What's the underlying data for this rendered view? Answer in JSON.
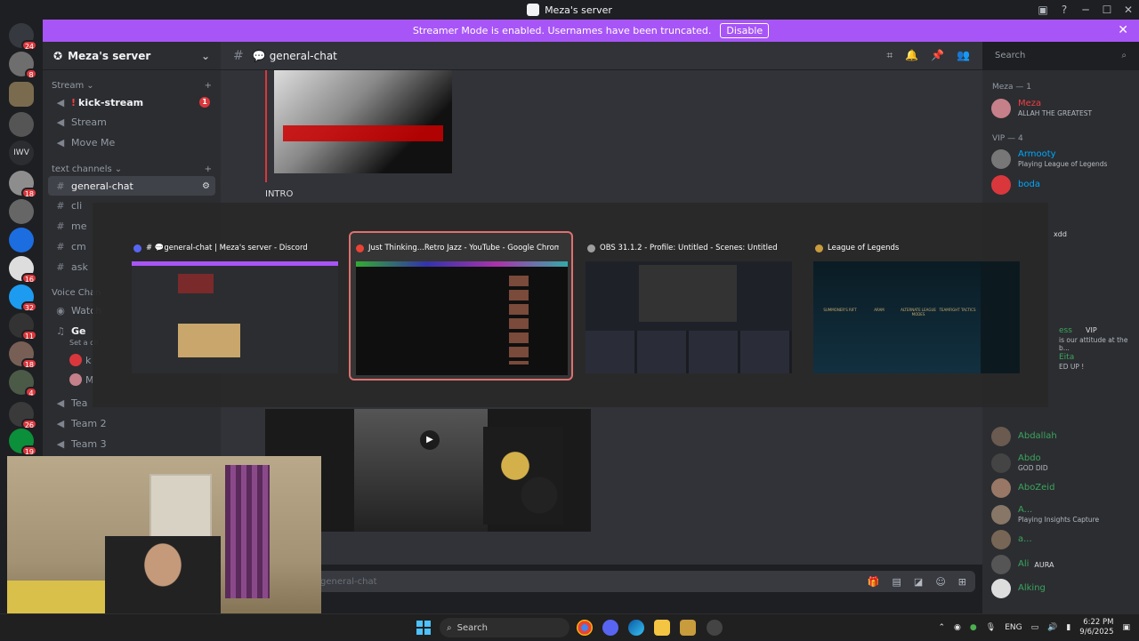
{
  "window": {
    "title": "Meza's server"
  },
  "banner": {
    "text": "Streamer Mode is enabled. Usernames have been truncated.",
    "disable_label": "Disable",
    "close_glyph": "✕"
  },
  "server_rail": {
    "badges": [
      "24",
      "8",
      "18",
      "16",
      "32",
      "11",
      "18",
      "4",
      "26",
      "19"
    ],
    "abbrev": "IWV"
  },
  "sidebar": {
    "server_name": "Meza's server",
    "stream_category": "Stream",
    "text_category": "text channels",
    "voice_category": "Voice Chan",
    "channels": {
      "kick": "kick-stream",
      "kick_unread": "1",
      "stream": "Stream",
      "moveme": "Move Me",
      "general": "general-chat",
      "clips": "cli",
      "me": "me",
      "cm": "cm",
      "ask": "ask",
      "watch": "Watch",
      "ge": "Ge",
      "ge_sub": "Set a ch",
      "k": "k",
      "m": "M",
      "team": "Tea",
      "team2": "Team 2",
      "team3": "Team 3"
    }
  },
  "chat_header": {
    "channel": "general-chat"
  },
  "search": {
    "placeholder": "Search"
  },
  "chat": {
    "intro": "INTRO",
    "composer_placeholder": "general-chat"
  },
  "members": {
    "group_owner": "Meza — 1",
    "group_vip": "VIP — 4",
    "list": [
      {
        "name": "Meza",
        "status": "ALLAH THE GREATEST",
        "color": "#f23f43"
      },
      {
        "name": "Armooty",
        "status": "Playing League of Legends",
        "color": "#00a8fc"
      },
      {
        "name": "boda",
        "status": "",
        "color": "#00a8fc"
      },
      {
        "name": "Abdallah",
        "status": "",
        "color": "#3ba55d"
      },
      {
        "name": "Abdo",
        "status": "GOD DID",
        "color": "#3ba55d"
      },
      {
        "name": "AboZeid",
        "status": "",
        "color": "#3ba55d"
      },
      {
        "name": "A...",
        "status": "Playing Insights Capture",
        "color": "#3ba55d"
      },
      {
        "name": "a...",
        "status": "",
        "color": "#3ba55d"
      },
      {
        "name": "Ali",
        "status": "AURA",
        "color": "#3ba55d"
      },
      {
        "name": "Alking",
        "status": "",
        "color": "#3ba55d"
      }
    ],
    "partial": {
      "xdd": "xdd",
      "ess": "ess",
      "vip": "VIP",
      "attitude": "is our attitude at the b...",
      "eita": "Eita",
      "eita_sub": "ED UP !"
    }
  },
  "switcher": {
    "windows": [
      {
        "title": "# 💬general-chat | Meza's server - Discord",
        "icon_color": "#5865f2"
      },
      {
        "title": "Just Thinking...Retro Jazz - YouTube - Google Chrome",
        "icon_color": "#ea4335"
      },
      {
        "title": "OBS 31.1.2 - Profile: Untitled - Scenes: Untitled",
        "icon_color": "#9e9e9e"
      },
      {
        "title": "League of Legends",
        "icon_color": "#c89b3c"
      }
    ],
    "lol_labels": [
      "SUMMONER'S RIFT",
      "ARAM",
      "ALTERNATE LEAGUE MODES",
      "TEAMFIGHT TACTICS"
    ]
  },
  "taskbar": {
    "search_label": "Search",
    "lang": "ENG",
    "time": "6:22 PM",
    "date": "9/6/2025"
  }
}
